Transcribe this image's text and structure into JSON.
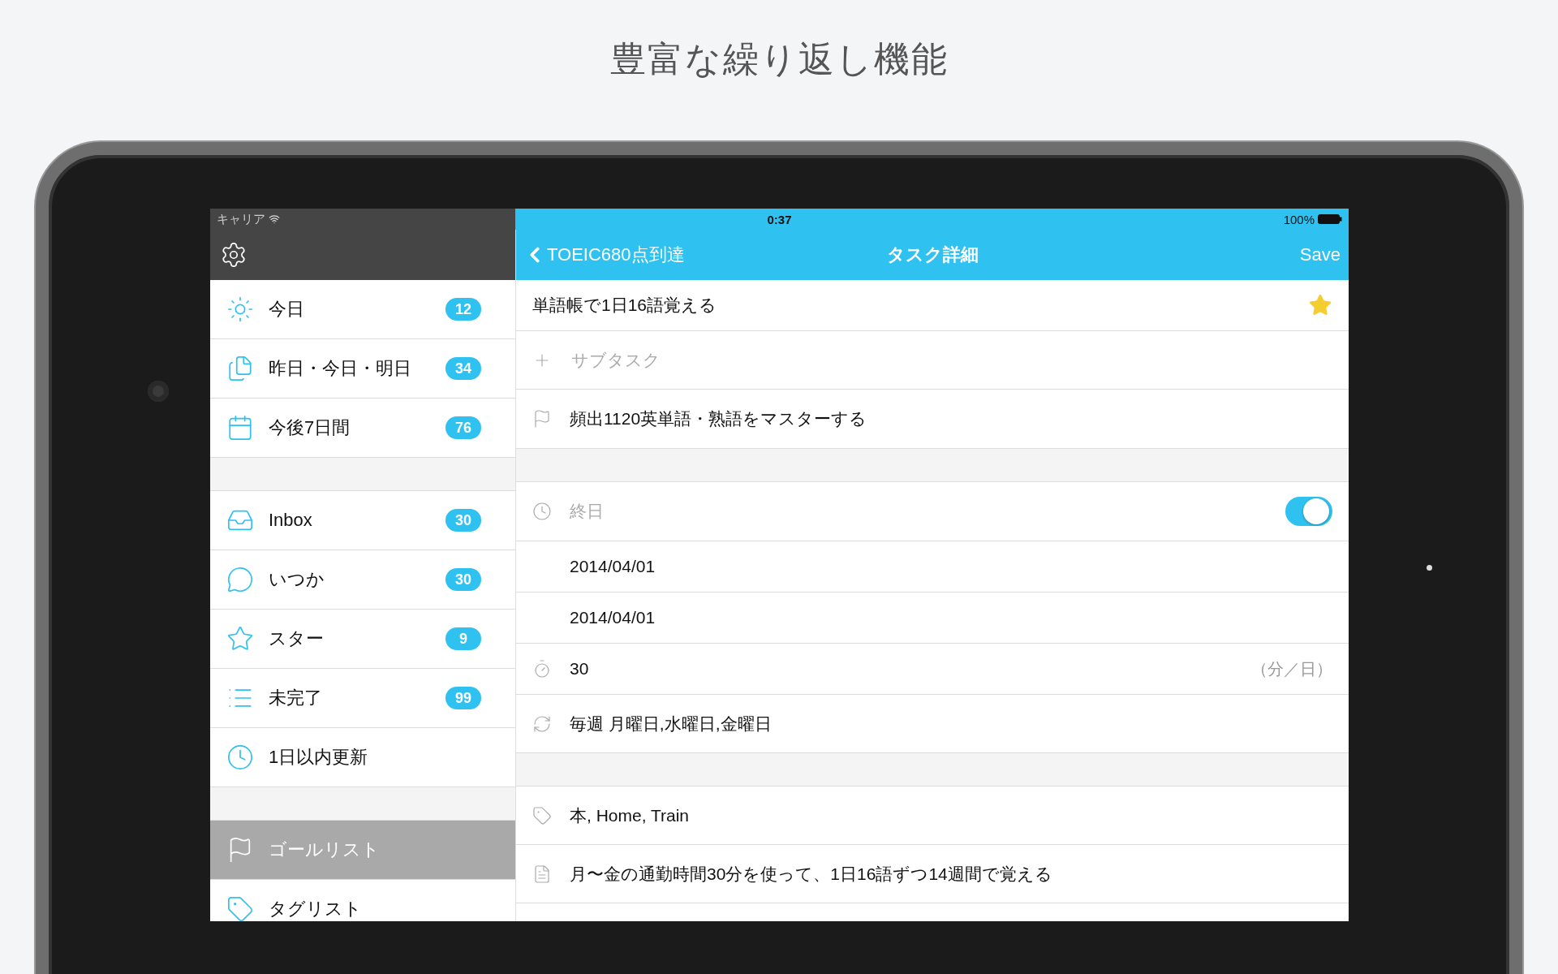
{
  "headline": "豊富な繰り返し機能",
  "status_bar": {
    "carrier": "キャリア",
    "time": "0:37",
    "battery": "100%"
  },
  "sidebar": {
    "sections": [
      {
        "items": [
          {
            "label": "今日",
            "count": "12",
            "selected": false
          },
          {
            "label": "昨日・今日・明日",
            "count": "34",
            "selected": false
          },
          {
            "label": "今後7日間",
            "count": "76",
            "selected": false
          }
        ]
      },
      {
        "items": [
          {
            "label": "Inbox",
            "count": "30",
            "selected": false
          },
          {
            "label": "いつか",
            "count": "30",
            "selected": false
          },
          {
            "label": "スター",
            "count": "9",
            "selected": false
          },
          {
            "label": "未完了",
            "count": "99",
            "selected": false
          },
          {
            "label": "1日以内更新",
            "selected": false
          }
        ]
      },
      {
        "items": [
          {
            "label": "ゴールリスト",
            "selected": true
          },
          {
            "label": "タグリスト",
            "selected": false
          }
        ]
      }
    ]
  },
  "nav": {
    "back": "TOEIC680点到達",
    "title": "タスク詳細",
    "action": "Save"
  },
  "detail": {
    "sections": [
      {
        "rows": [
          {
            "kind": "title",
            "text": "単語帳で1日16語覚える",
            "starred": true
          },
          {
            "kind": "subtask",
            "placeholder": "サブタスク"
          },
          {
            "kind": "goal",
            "text": "頻出1120英単語・熟語をマスターする"
          }
        ]
      },
      {
        "rows": [
          {
            "kind": "allday",
            "text": "終日",
            "on": true
          },
          {
            "kind": "date",
            "text": "2014/04/01"
          },
          {
            "kind": "date",
            "text": "2014/04/01"
          },
          {
            "kind": "duration",
            "text": "30",
            "unit": "（分／日）"
          },
          {
            "kind": "repeat",
            "text": "毎週 月曜日,水曜日,金曜日"
          }
        ]
      },
      {
        "rows": [
          {
            "kind": "tags",
            "text": "本, Home, Train"
          },
          {
            "kind": "memo",
            "text": "月〜金の通勤時間30分を使って、1日16語ずつ14週間で覚える"
          }
        ]
      }
    ]
  }
}
